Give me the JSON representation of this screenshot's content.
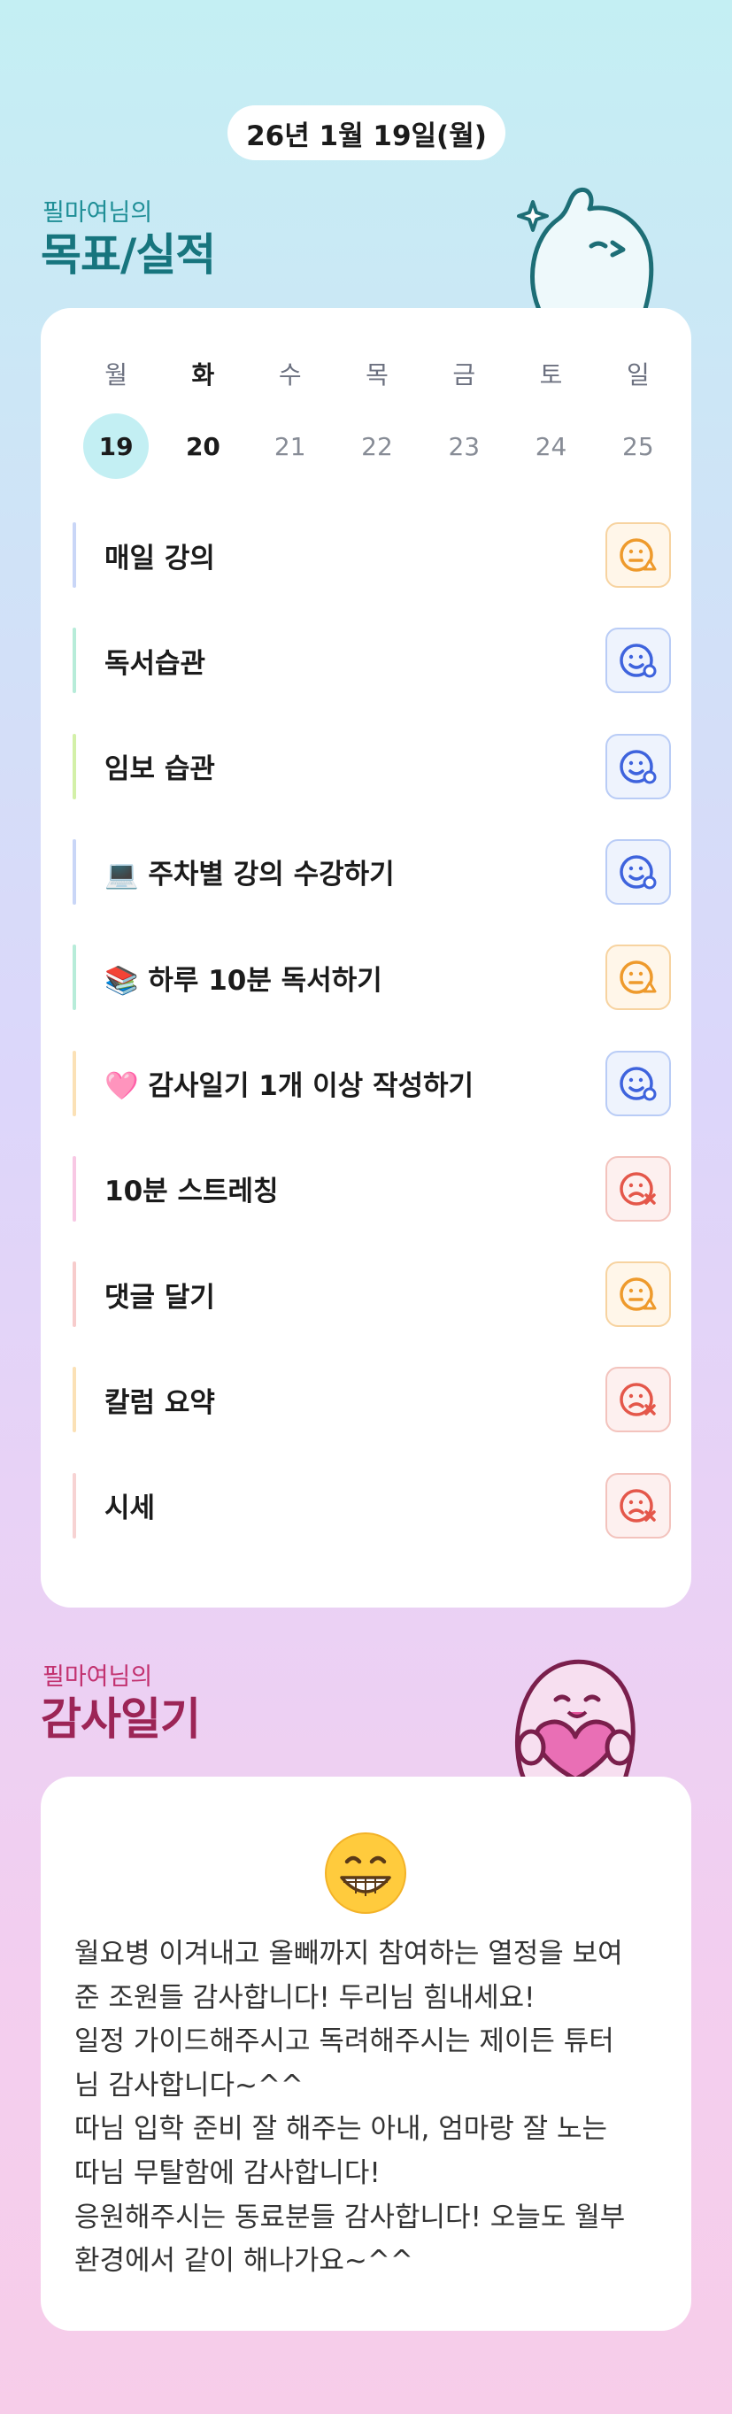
{
  "date_header": "26년 1월 19일(월)",
  "goals_section": {
    "subtitle": "필마여님의",
    "title": "목표/실적",
    "week": {
      "days": [
        "월",
        "화",
        "수",
        "목",
        "금",
        "토",
        "일"
      ],
      "dates": [
        "19",
        "20",
        "21",
        "22",
        "23",
        "24",
        "25"
      ]
    },
    "items": [
      {
        "label": "매일 강의",
        "status": "meh-face-icon",
        "bar_color": "#c9d6f7"
      },
      {
        "label": "독서습관",
        "status": "happy-face-icon",
        "bar_color": "#b7ecd9"
      },
      {
        "label": "임보 습관",
        "status": "happy-face-icon",
        "bar_color": "#d3f0a8"
      },
      {
        "label": "💻 주차별 강의 수강하기",
        "status": "happy-face-icon",
        "bar_color": "#c9d6f7"
      },
      {
        "label": "📚 하루 10분 독서하기",
        "status": "meh-face-icon",
        "bar_color": "#b7ecd9"
      },
      {
        "label": "🩷 감사일기 1개 이상 작성하기",
        "status": "happy-face-icon",
        "bar_color": "#fbe1b6"
      },
      {
        "label": "10분 스트레칭",
        "status": "sad-face-icon",
        "bar_color": "#f8c8e4"
      },
      {
        "label": "댓글 달기",
        "status": "meh-face-icon",
        "bar_color": "#f7cccc"
      },
      {
        "label": "칼럼 요약",
        "status": "sad-face-icon",
        "bar_color": "#fbe1b6"
      },
      {
        "label": "시세",
        "status": "sad-face-icon",
        "bar_color": "#f7d3d3"
      }
    ]
  },
  "gratitude_section": {
    "subtitle": "필마여님의",
    "title": "감사일기",
    "emoji": "grinning-face-icon",
    "text": "월요병 이겨내고 올빼까지 참여하는 열정을 보여\n준 조원들 감사합니다! 두리님 힘내세요!\n일정 가이드해주시고 독려해주시는 제이든 튜터\n님 감사합니다~^^\n따님 입학 준비 잘 해주는 아내, 엄마랑 잘 노는\n따님 무탈함에 감사합니다!\n응원해주시는 동료분들 감사합니다! 오늘도 월부\n환경에서 같이 해나가요~^^"
  },
  "colors": {
    "good": "#3e63dd",
    "meh": "#ee9a2c",
    "bad": "#e4574a",
    "today_circle": "#c3eff3"
  }
}
